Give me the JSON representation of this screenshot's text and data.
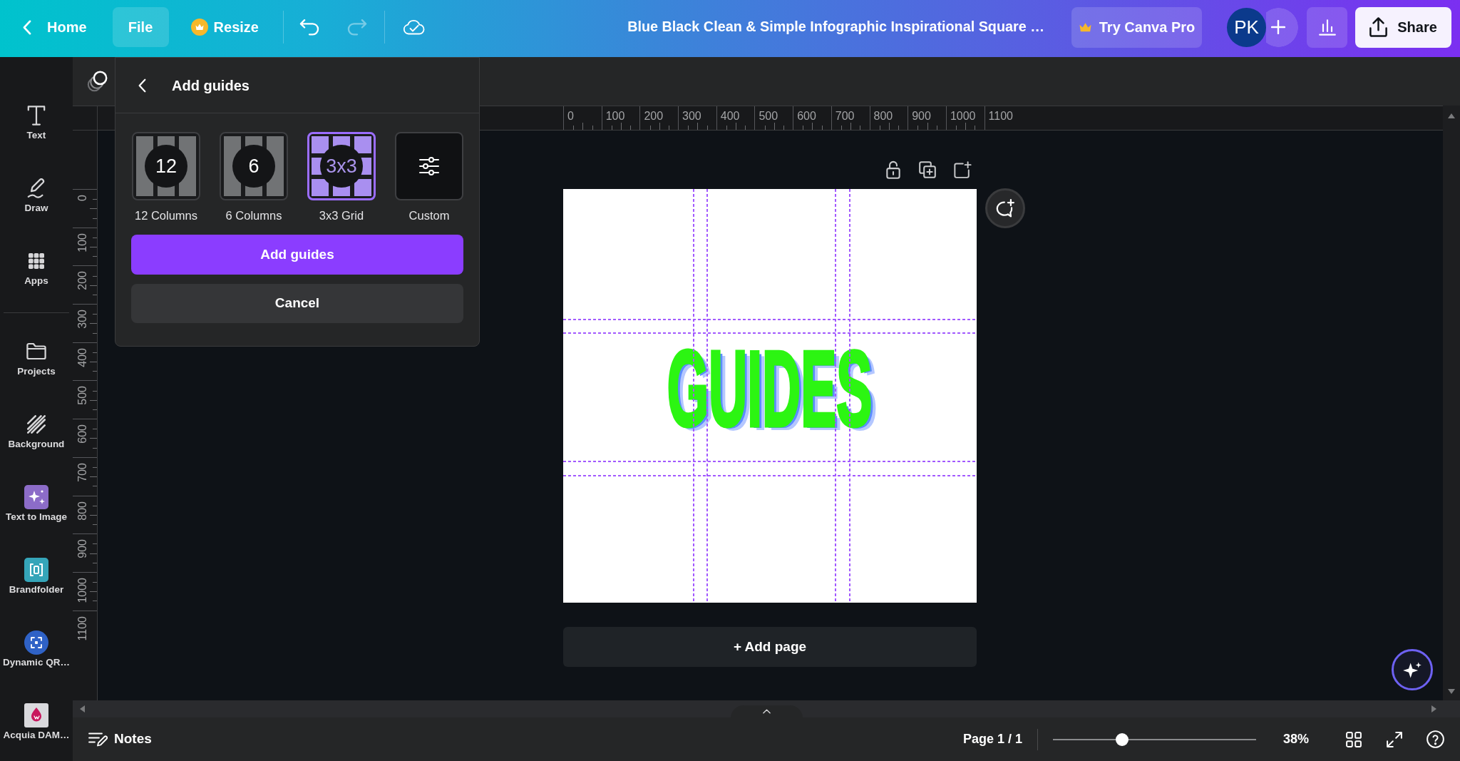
{
  "top_bar": {
    "home_button": "Home",
    "file_button": "File",
    "resize_button": "Resize",
    "document_title": "Blue Black Clean & Simple Infographic Inspirational Square …",
    "pro_button": "Try Canva Pro",
    "avatar": "PK",
    "share_button": "Share"
  },
  "sidebar": {
    "sections": [
      {
        "items": [
          {
            "kind": "text",
            "label": "Text"
          },
          {
            "kind": "draw",
            "label": "Draw"
          },
          {
            "kind": "apps",
            "label": "Apps"
          }
        ]
      },
      {
        "items": [
          {
            "kind": "projects",
            "label": "Projects"
          },
          {
            "kind": "background",
            "label": "Background"
          },
          {
            "kind": "ai",
            "label": "Text to Image"
          },
          {
            "kind": "brand",
            "label": "Brandfolder"
          },
          {
            "kind": "qr",
            "label": "Dynamic QR…"
          },
          {
            "kind": "dam",
            "label": "Acquia DAM…"
          }
        ]
      }
    ]
  },
  "guides_panel": {
    "title": "Add guides",
    "options": [
      {
        "kind": "columns",
        "badge": "12",
        "label": "12 Columns",
        "selected": false
      },
      {
        "kind": "columns",
        "badge": "6",
        "label": "6 Columns",
        "selected": false
      },
      {
        "kind": "grid",
        "badge": "3x3",
        "label": "3x3 Grid",
        "selected": true
      },
      {
        "kind": "custom",
        "label": "Custom",
        "selected": false
      }
    ],
    "apply_button": "Add guides",
    "cancel_button": "Cancel"
  },
  "rulers": {
    "horizontal": [
      "0",
      "100",
      "200",
      "300",
      "400",
      "500",
      "600",
      "700",
      "800",
      "900",
      "1000",
      "1100"
    ],
    "vertical": [
      "0",
      "100",
      "200",
      "300",
      "400",
      "500",
      "600",
      "700",
      "800",
      "900",
      "1000",
      "1100"
    ]
  },
  "page": {
    "heading": "GUIDES"
  },
  "add_page_button": "+ Add page",
  "bottom_bar": {
    "notes_button": "Notes",
    "page_indicator": "Page 1 / 1",
    "zoom": {
      "level": 0.34,
      "reading": "38%"
    }
  }
}
